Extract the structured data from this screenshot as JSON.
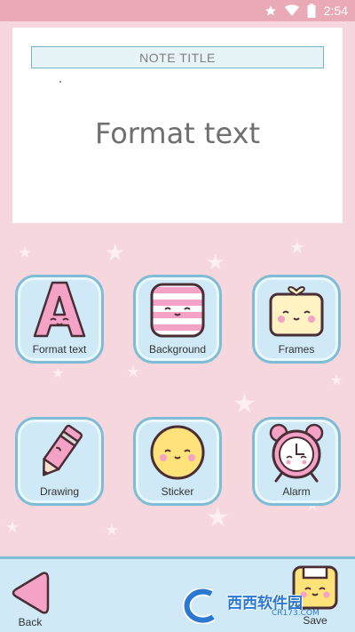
{
  "status_bar": {
    "time": "2:54",
    "icons": [
      "star-icon",
      "wifi-icon",
      "battery-icon"
    ]
  },
  "note": {
    "title": "NOTE TITLE",
    "body": "Format text"
  },
  "tools": [
    {
      "label": "Format text",
      "icon": "letter-a-icon"
    },
    {
      "label": "Background",
      "icon": "striped-square-icon"
    },
    {
      "label": "Frames",
      "icon": "frame-icon"
    },
    {
      "label": "Drawing",
      "icon": "pencil-icon"
    },
    {
      "label": "Sticker",
      "icon": "smiley-sticker-icon"
    },
    {
      "label": "Alarm",
      "icon": "alarm-clock-icon"
    }
  ],
  "bottom_bar": {
    "back_label": "Back",
    "save_label": "Save"
  },
  "watermark": {
    "text": "西西软件园",
    "sub": "CR173.COM"
  },
  "colors": {
    "status_bar": "#e9a9b7",
    "background": "#f7d7de",
    "button_fill": "#cfe9f6",
    "button_border": "#7fbcd6",
    "accent_pink": "#f4a2c5",
    "note_title_border": "#79b4c6"
  }
}
